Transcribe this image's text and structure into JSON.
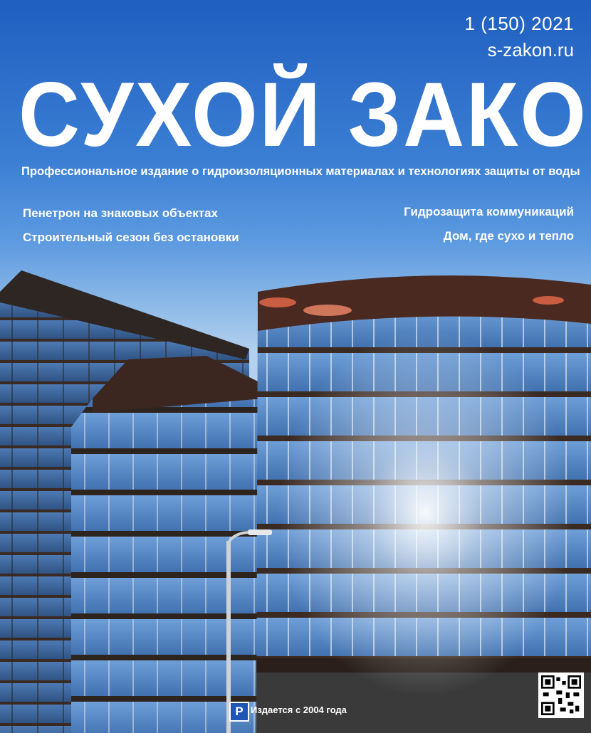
{
  "cover": {
    "issue": "1 (150) 2021",
    "website": "s-zakon.ru",
    "masthead": "СУХОЙ ЗАКОН",
    "tagline": "Профессиональное издание о гидроизоляционных материалах и технологиях защиты от воды",
    "headlines_left": [
      "Пенетрон на знаковых объектах",
      "Строительный сезон без остановки"
    ],
    "headlines_right": [
      "Гидрозащита коммуникаций",
      "Дом, где сухо и тепло"
    ],
    "since": "Издается с 2004 года",
    "parking_sign": "P"
  },
  "colors": {
    "sky_top": "#1f5fc0",
    "sky_bottom": "#b3d0ee",
    "text": "#ffffff",
    "glass": "#4a7fc0",
    "frame": "#3a2a22"
  },
  "icons": [
    "parking-sign-icon",
    "qr-code-icon"
  ]
}
